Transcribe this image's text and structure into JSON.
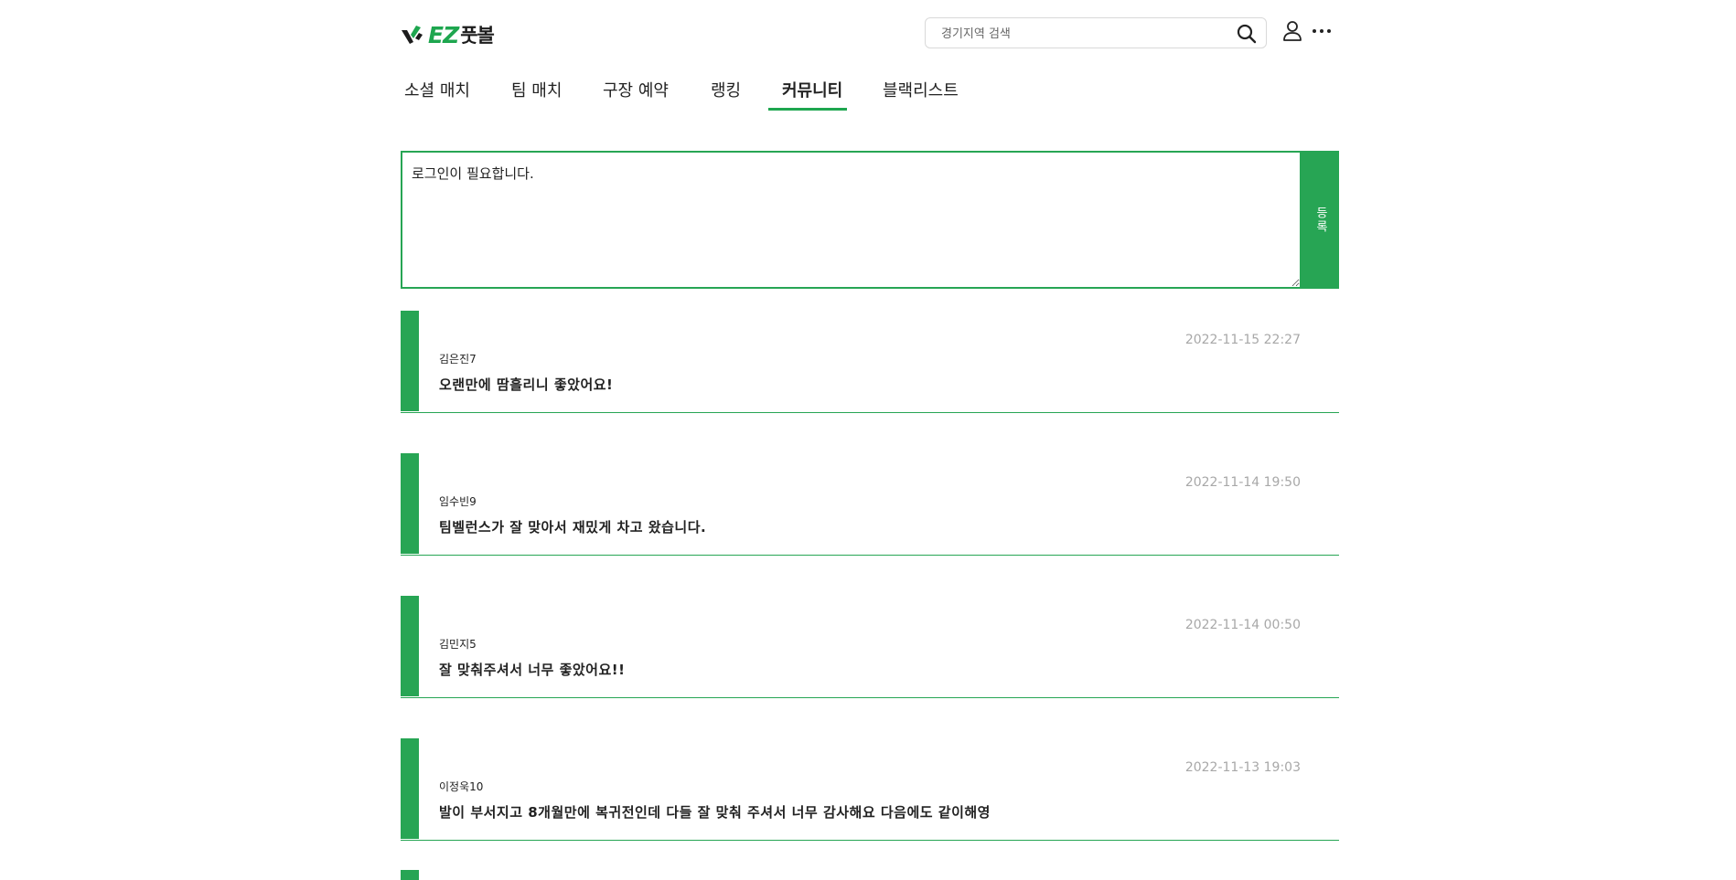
{
  "brand": {
    "logo_ez": "EZ",
    "logo_kr": "풋볼",
    "accent": "#1ea64f",
    "green": "#27a554"
  },
  "header": {
    "search_placeholder": "경기지역 검색",
    "icons": [
      "search-icon",
      "user-icon",
      "more-icon"
    ]
  },
  "tabs": [
    {
      "label": "소셜 매치",
      "active": false
    },
    {
      "label": "팀 매치",
      "active": false
    },
    {
      "label": "구장 예약",
      "active": false
    },
    {
      "label": "랭킹",
      "active": false
    },
    {
      "label": "커뮤니티",
      "active": true
    },
    {
      "label": "블랙리스트",
      "active": false
    }
  ],
  "comment_form": {
    "placeholder": "로그인이 필요합니다.",
    "submit_label": "등록"
  },
  "posts": [
    {
      "author": "김은진7",
      "date": "2022-11-15 22:27",
      "text": "오랜만에 땀흘리니 좋았어요!"
    },
    {
      "author": "임수빈9",
      "date": "2022-11-14 19:50",
      "text": "팀벨런스가 잘 맞아서 재밌게 차고 왔습니다."
    },
    {
      "author": "김민지5",
      "date": "2022-11-14 00:50",
      "text": "잘 맞춰주셔서 너무 좋았어요!!"
    },
    {
      "author": "이정욱10",
      "date": "2022-11-13 19:03",
      "text": "발이 부서지고 8개월만에 복귀전인데 다들 잘 맞춰 주셔서 너무 감사해요 다음에도 같이해영"
    }
  ]
}
